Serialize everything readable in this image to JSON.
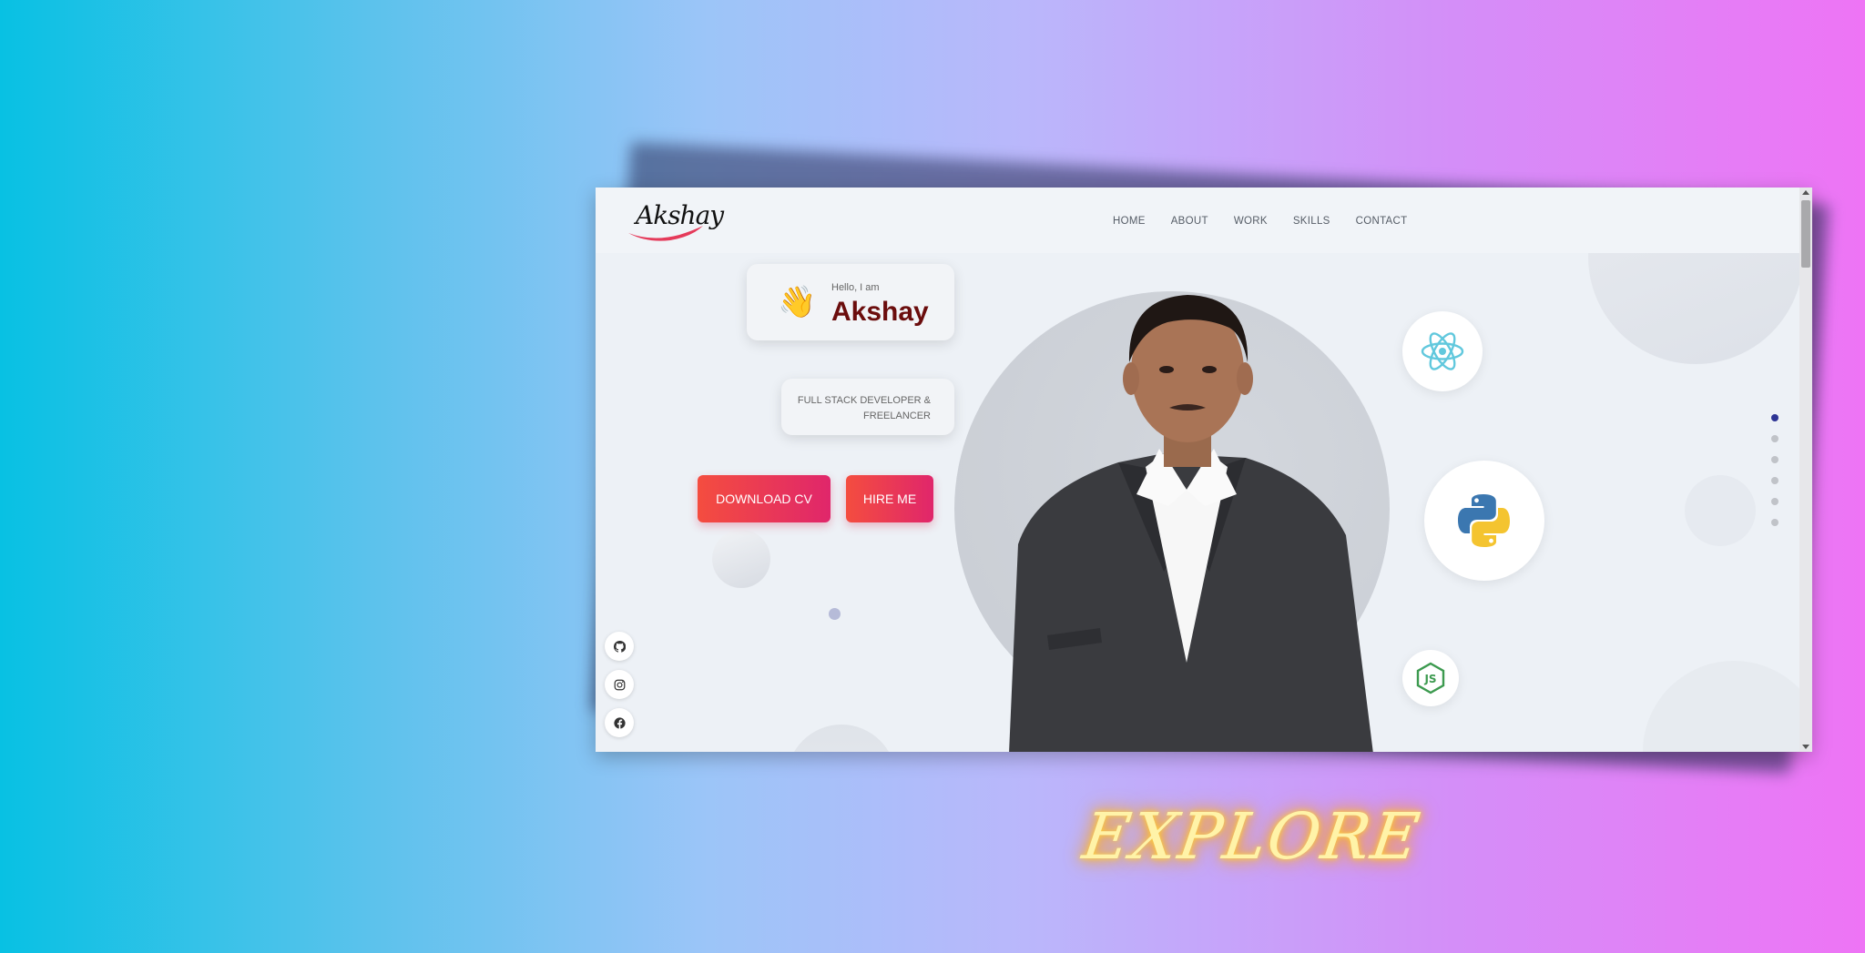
{
  "logo": {
    "text": "Akshay"
  },
  "nav": {
    "items": [
      "HOME",
      "ABOUT",
      "WORK",
      "SKILLS",
      "CONTACT"
    ]
  },
  "hero": {
    "greeting": "Hello, I am",
    "name": "Akshay",
    "role": "FULL STACK DEVELOPER & FREELANCER",
    "wave_emoji": "👋",
    "download_label": "DOWNLOAD CV",
    "hire_label": "HIRE ME"
  },
  "social": [
    "github-icon",
    "instagram-icon",
    "facebook-icon"
  ],
  "tech_icons": [
    "react-icon",
    "python-icon",
    "nodejs-icon"
  ],
  "section_dots": {
    "count": 6,
    "active_index": 0
  },
  "overlay_text": "EXPLORE",
  "colors": {
    "name": "#6b0d0d",
    "button_gradient_start": "#f44d3f",
    "button_gradient_end": "#e0266b",
    "active_dot": "#2d3494",
    "explore_glow": "#ffb020"
  }
}
